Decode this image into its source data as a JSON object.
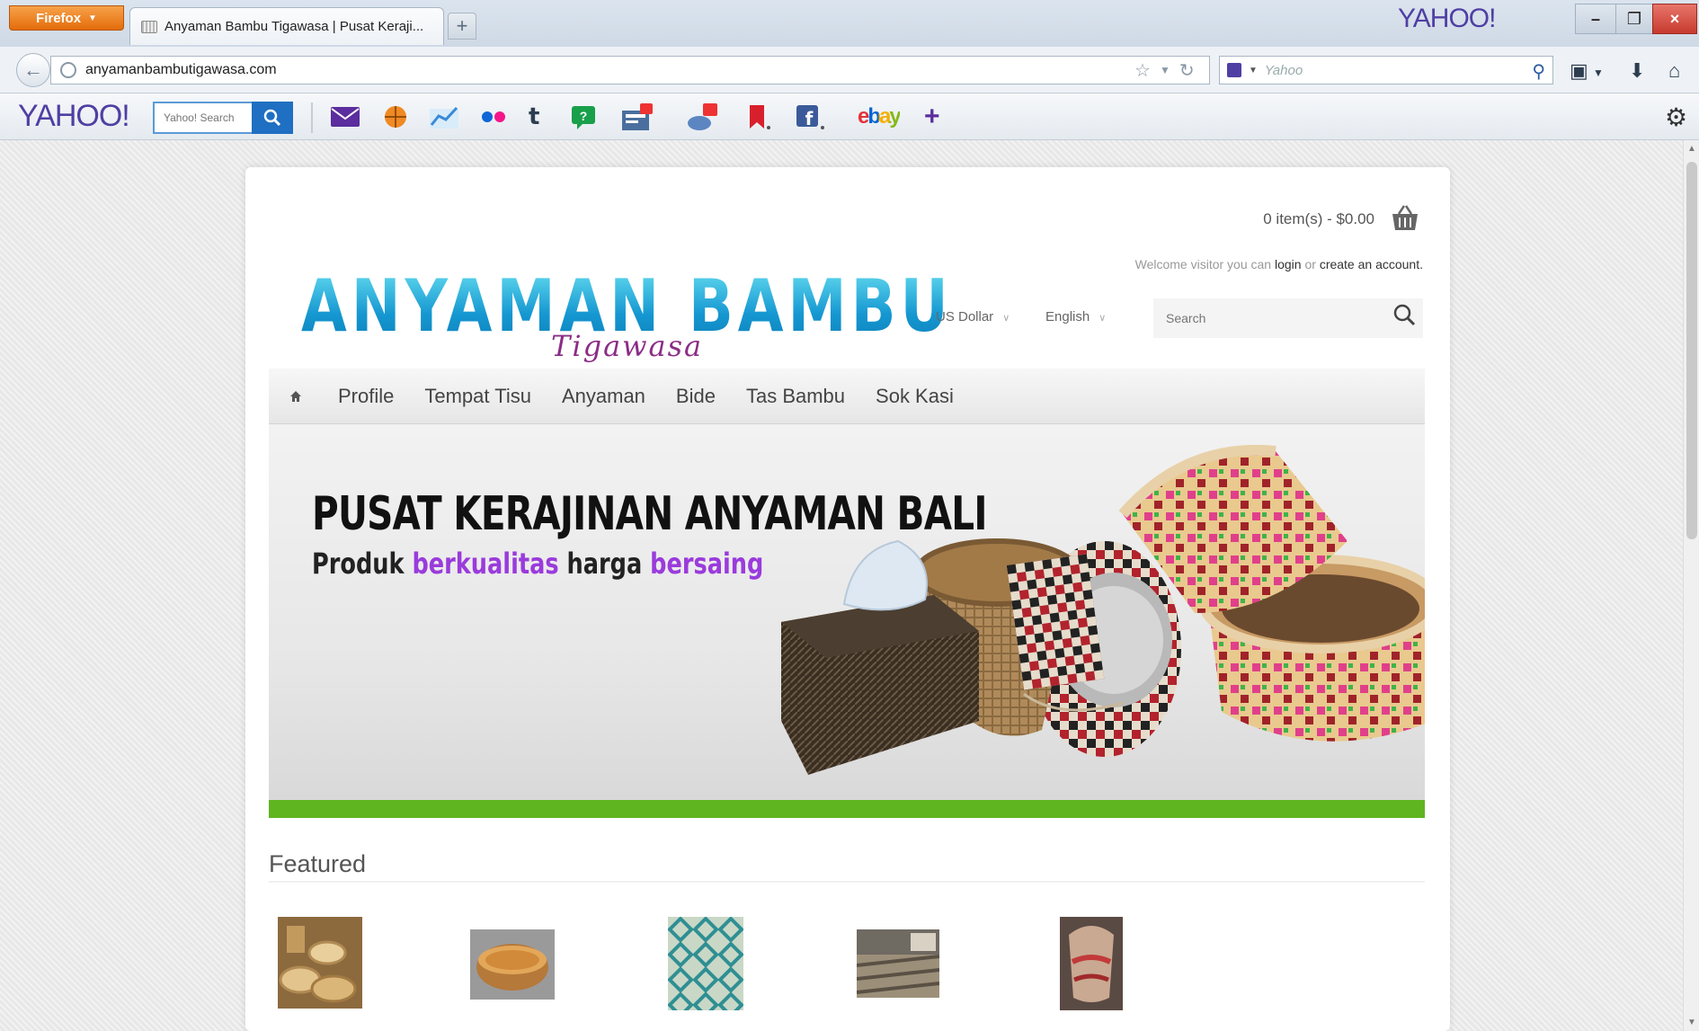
{
  "browser": {
    "app_button": "Firefox",
    "tab_title": "Anyaman Bambu Tigawasa | Pusat Keraji...",
    "new_tab": "+",
    "title_logo": "YAHOO!",
    "url": "anyamanbambutigawasa.com",
    "search_placeholder": "Yahoo",
    "window_controls": {
      "minimize": "–",
      "maximize": "❐",
      "close": "×"
    }
  },
  "yahoo_toolbar": {
    "logo": "YAHOO!",
    "search_placeholder": "Yahoo! Search",
    "tools": [
      "mail-icon",
      "basketball-icon",
      "finance-icon",
      "flickr-icon",
      "tumblr-icon",
      "answers-icon",
      "news-icon",
      "weather-icon",
      "bookmarks-icon",
      "facebook-icon",
      "ebay-icon",
      "add-icon"
    ],
    "ebay_label": "ebay",
    "tumblr_label": "t",
    "facebook_label": "f",
    "add_label": "+"
  },
  "header": {
    "cart_summary": "0 item(s) - $0.00",
    "welcome_prefix": "Welcome visitor you can",
    "login_link": "login",
    "or_text": "or",
    "create_account_link": "create an account.",
    "logo_main": "ANYAMAN BAMBU",
    "logo_sub": "Tigawasa",
    "currency": "US Dollar",
    "language": "English",
    "search_placeholder": "Search"
  },
  "menu": {
    "home_icon": "home-icon",
    "items": [
      "Profile",
      "Tempat Tisu",
      "Anyaman",
      "Bide",
      "Tas Bambu",
      "Sok Kasi"
    ]
  },
  "banner": {
    "title": "PUSAT KERAJINAN ANYAMAN BALI",
    "tagline_1": "Produk",
    "tagline_2": "berkualitas",
    "tagline_3": "harga",
    "tagline_4": "bersaing"
  },
  "featured": {
    "title": "Featured",
    "products": [
      "product-thumb-1",
      "product-thumb-2",
      "product-thumb-3",
      "product-thumb-4",
      "product-thumb-5"
    ]
  },
  "colors": {
    "accent_green": "#5fb51f",
    "logo_blue": "#1597d1",
    "logo_purple": "#8b2d86",
    "tagline_purple": "#9a3bdc",
    "yahoo_purple": "#4f3fa3",
    "firefox_orange": "#e46c0a"
  }
}
